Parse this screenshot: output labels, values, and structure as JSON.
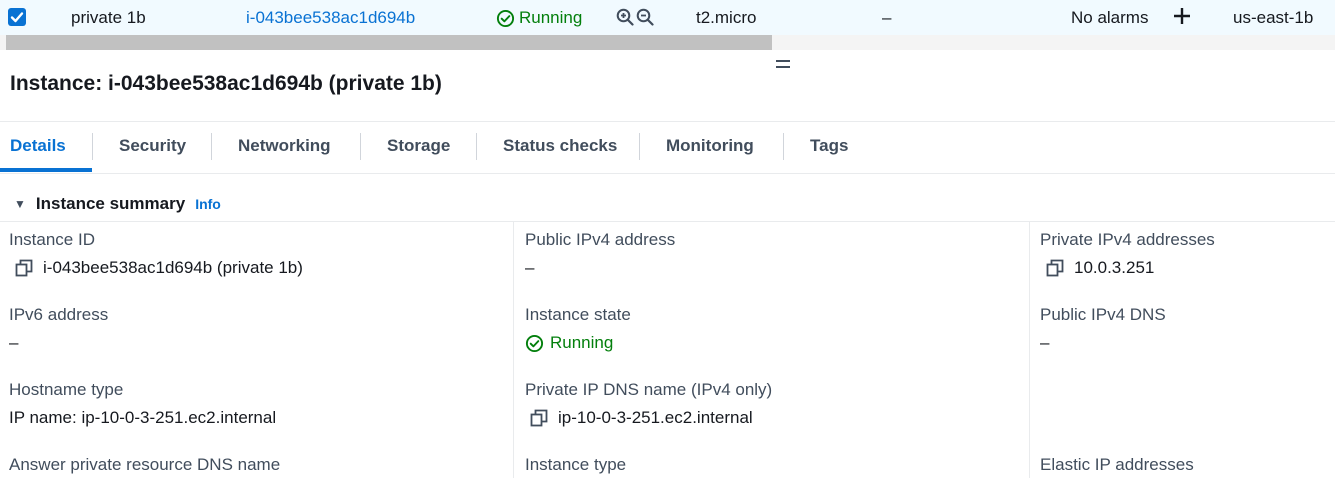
{
  "table_row": {
    "selected": true,
    "name": "private 1b",
    "instance_id": "i-043bee538ac1d694b",
    "state": "Running",
    "instance_type": "t2.micro",
    "status_check": "–",
    "alarms": "No alarms",
    "availability_zone": "us-east-1b"
  },
  "colors": {
    "link": "#0972d3",
    "running": "#037f0c",
    "selected_row": "#f1faff"
  },
  "title": "Instance: i-043bee538ac1d694b (private 1b)",
  "tabs": [
    {
      "label": "Details",
      "active": true
    },
    {
      "label": "Security"
    },
    {
      "label": "Networking"
    },
    {
      "label": "Storage"
    },
    {
      "label": "Status checks"
    },
    {
      "label": "Monitoring"
    },
    {
      "label": "Tags"
    }
  ],
  "summary": {
    "heading": "Instance summary",
    "info_link": "Info",
    "fields": {
      "instance_id": {
        "label": "Instance ID",
        "value": "i-043bee538ac1d694b (private 1b)"
      },
      "public_ipv4": {
        "label": "Public IPv4 address",
        "value": "–"
      },
      "private_ipv4": {
        "label": "Private IPv4 addresses",
        "value": "10.0.3.251"
      },
      "ipv6": {
        "label": "IPv6 address",
        "value": "–"
      },
      "instance_state": {
        "label": "Instance state",
        "value": "Running"
      },
      "public_dns": {
        "label": "Public IPv4 DNS",
        "value": "–"
      },
      "hostname_type": {
        "label": "Hostname type",
        "value": "IP name: ip-10-0-3-251.ec2.internal"
      },
      "private_dns": {
        "label": "Private IP DNS name (IPv4 only)",
        "value": "ip-10-0-3-251.ec2.internal"
      },
      "answer_dns": {
        "label": "Answer private resource DNS name"
      },
      "instance_type": {
        "label": "Instance type"
      },
      "elastic_ip": {
        "label": "Elastic IP addresses"
      }
    }
  }
}
